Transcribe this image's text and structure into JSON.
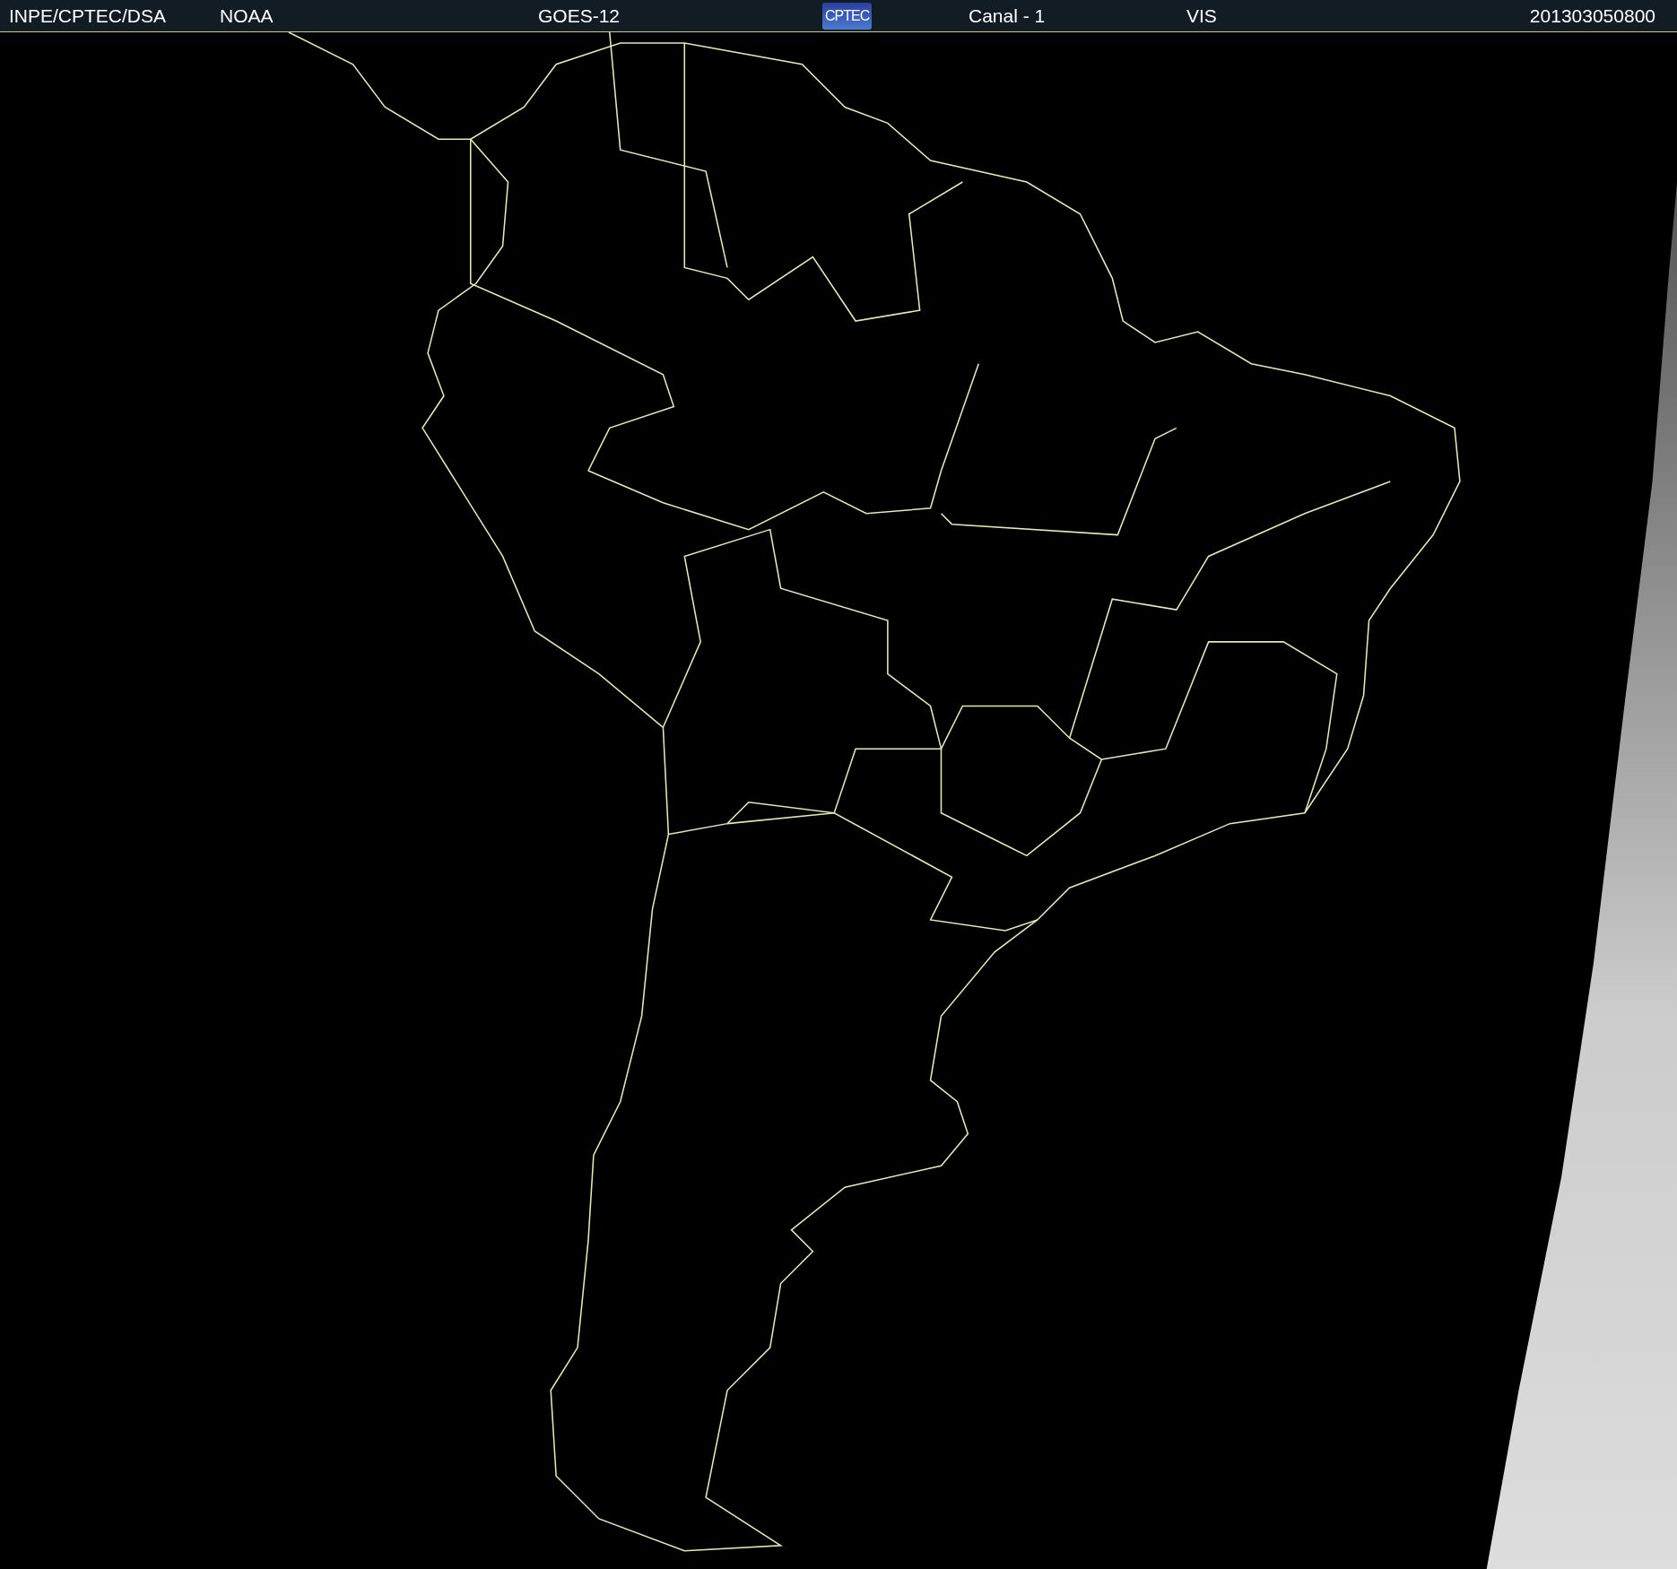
{
  "header": {
    "source": "INPE/CPTEC/DSA",
    "agency": "NOAA",
    "satellite": "GOES-12",
    "logo": "CPTEC",
    "channel": "Canal - 1",
    "band": "VIS",
    "timestamp": "201303050800"
  }
}
